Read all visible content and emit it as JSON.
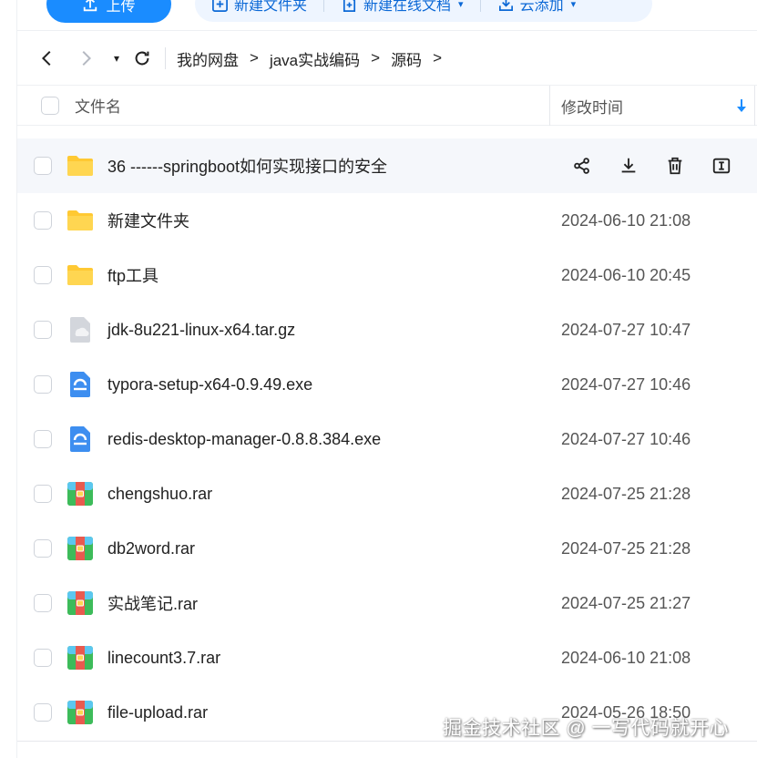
{
  "toolbar": {
    "upload_label": "上传",
    "new_folder_label": "新建文件夹",
    "new_online_doc_label": "新建在线文档",
    "cloud_add_label": "云添加",
    "caret": "▾"
  },
  "nav": {
    "dropdown_glyph": "▾",
    "breadcrumbs": [
      {
        "label": "我的网盘"
      },
      {
        "label": "java实战编码"
      },
      {
        "label": "源码"
      }
    ],
    "crumb_separator": ">"
  },
  "columns": {
    "name": "文件名",
    "modified": "修改时间"
  },
  "colors": {
    "accent": "#1a8cff",
    "folder": "#ffc933",
    "archive_green": "#3dbb5a",
    "archive_red": "#e85a4f",
    "exe_blue": "#3d8ef0",
    "gz_gray": "#c9ccd3"
  },
  "files": [
    {
      "name": "36 ------springboot如何实现接口的安全",
      "time": "",
      "icon": "folder-icon",
      "hovered": true
    },
    {
      "name": "新建文件夹",
      "time": "2024-06-10 21:08",
      "icon": "folder-icon"
    },
    {
      "name": "ftp工具",
      "time": "2024-06-10 20:45",
      "icon": "folder-icon"
    },
    {
      "name": "jdk-8u221-linux-x64.tar.gz",
      "time": "2024-07-27 10:47",
      "icon": "gz-file-icon"
    },
    {
      "name": "typora-setup-x64-0.9.49.exe",
      "time": "2024-07-27 10:46",
      "icon": "exe-file-icon"
    },
    {
      "name": "redis-desktop-manager-0.8.8.384.exe",
      "time": "2024-07-27 10:46",
      "icon": "exe-file-icon"
    },
    {
      "name": "chengshuo.rar",
      "time": "2024-07-25 21:28",
      "icon": "rar-file-icon"
    },
    {
      "name": "db2word.rar",
      "time": "2024-07-25 21:28",
      "icon": "rar-file-icon"
    },
    {
      "name": "实战笔记.rar",
      "time": "2024-07-25 21:27",
      "icon": "rar-file-icon"
    },
    {
      "name": "linecount3.7.rar",
      "time": "2024-06-10 21:08",
      "icon": "rar-file-icon"
    },
    {
      "name": "file-upload.rar",
      "time": "2024-05-26 18:50",
      "icon": "rar-file-icon"
    }
  ],
  "watermark": "掘金技术社区 @ 一写代码就开心"
}
